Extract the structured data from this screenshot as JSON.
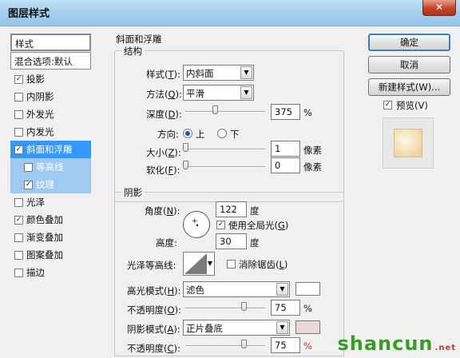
{
  "window": {
    "title": "图层样式",
    "close": "✕"
  },
  "left": {
    "header": "样式",
    "blend": "混合选项:默认",
    "items": [
      {
        "label": "投影",
        "checked": true
      },
      {
        "label": "内阴影",
        "checked": false
      },
      {
        "label": "外发光",
        "checked": false
      },
      {
        "label": "内发光",
        "checked": false
      },
      {
        "label": "斜面和浮雕",
        "checked": true,
        "selected": true
      },
      {
        "label": "等高线",
        "checked": false,
        "sub": true
      },
      {
        "label": "纹理",
        "checked": true,
        "sub": true
      },
      {
        "label": "光泽",
        "checked": false
      },
      {
        "label": "颜色叠加",
        "checked": true
      },
      {
        "label": "渐变叠加",
        "checked": false
      },
      {
        "label": "图案叠加",
        "checked": false
      },
      {
        "label": "描边",
        "checked": false
      }
    ]
  },
  "bevel": {
    "title": "斜面和浮雕",
    "structure": "结构",
    "style_label": "样式(T):",
    "style_label_plain": "样式(",
    "style_key": "T",
    "style_end": "):",
    "style_value": "内斜面",
    "technique_plain": "方法(",
    "technique_key": "Q",
    "technique_value": "平滑",
    "depth_plain": "深度(",
    "depth_key": "D",
    "depth_value": "375",
    "depth_unit": "%",
    "direction_label": "方向:",
    "dir_up": "上",
    "dir_down": "下",
    "size_plain": "大小(",
    "size_key": "Z",
    "size_value": "1",
    "size_unit": "像素",
    "soften_plain": "软化(",
    "soften_key": "F",
    "soften_value": "0",
    "soften_unit": "像素"
  },
  "shading": {
    "title": "阴影",
    "angle_plain": "角度(",
    "angle_key": "N",
    "angle_value": "122",
    "angle_unit": "度",
    "global_light": "使用全局光(",
    "global_key": "G",
    "altitude_label": "高度:",
    "altitude_value": "30",
    "altitude_unit": "度",
    "gloss_label": "光泽等高线:",
    "antialias": "消除锯齿(",
    "antialias_key": "L",
    "highlight_plain": "高光模式(",
    "highlight_key": "H",
    "highlight_value": "滤色",
    "opacity1_plain": "不透明度(",
    "opacity1_key": "O",
    "opacity1_value": "75",
    "shadow_plain": "阴影模式(",
    "shadow_key": "A",
    "shadow_value": "正片叠底",
    "opacity2_plain": "不透明度(",
    "opacity2_key": "C",
    "opacity2_value": "75",
    "percent": "%",
    "highlight_color": "#ffffff",
    "shadow_color": "#e8d8d8"
  },
  "buttons": {
    "ok": "确定",
    "cancel": "取消",
    "new_style": "新建样式(W)...",
    "preview": "预览(V)"
  },
  "watermark": {
    "text": "shancun",
    "small": ".net"
  }
}
